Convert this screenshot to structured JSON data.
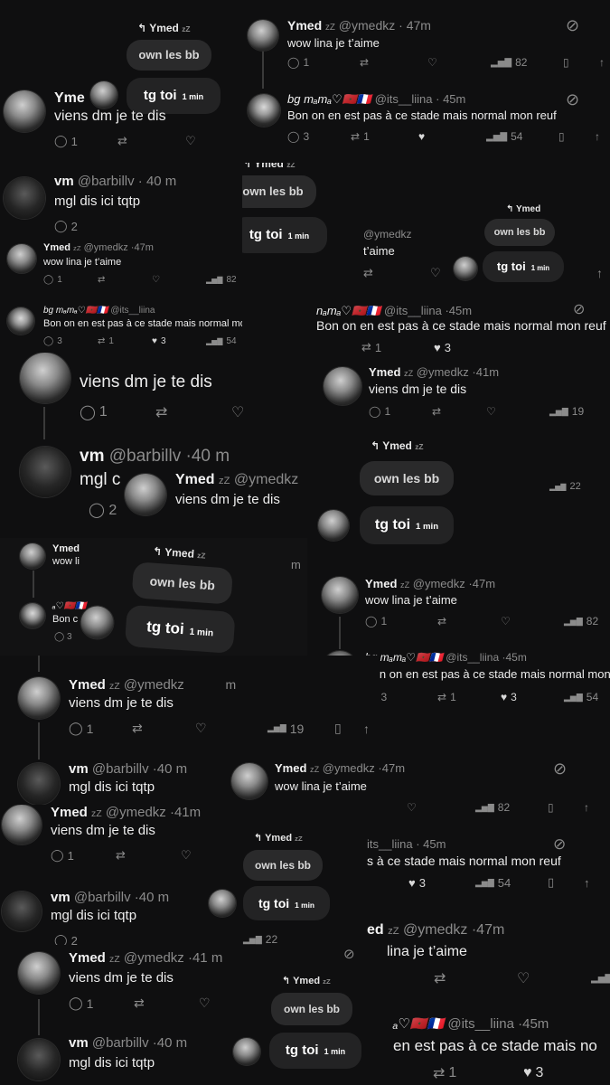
{
  "users": {
    "ymed": {
      "name": "Ymed",
      "handle": "@ymedkz",
      "zz": "zZ"
    },
    "vm": {
      "name": "vm",
      "handle": "@barbillv"
    },
    "lina": {
      "name": "bɡ mₐmₐ♡🇲🇦🇫🇷",
      "handle": "@its__liina"
    }
  },
  "tweets": {
    "t_wow": {
      "text": "wow lina je t’aime",
      "time": "47m",
      "replies": "1",
      "views": "82"
    },
    "t_bon": {
      "text": "Bon on en est pas à ce stade mais normal mon reuf",
      "time": "45m",
      "replies": "3",
      "retweets": "1",
      "likes": "3",
      "views": "54"
    },
    "t_viens": {
      "text": "viens dm je te dis",
      "time": "41m",
      "time_alt": "41 m",
      "replies": "1",
      "views": "19"
    },
    "t_mgl": {
      "text": "mgl dis ici tqtp",
      "time": "40 m",
      "replies": "2",
      "views": "22"
    }
  },
  "dm": {
    "reply_to": "Ymed",
    "bubble1": "own les bb",
    "bubble2": "tg toi",
    "bubble2_time": "1 min"
  },
  "fragments": {
    "frag_aime": "t’aime",
    "frag_min": "min",
    "frag_m": "m",
    "frag_stade": "s à ce stade mais normal mon reuf",
    "frag_linaaime": "lina je t’aime",
    "frag_its": "its__liina · 45m",
    "frag_bon2": "en est pas à ce stade mais normal mon reuf",
    "frag_bonshort": "en est pas à ce stade mais no",
    "frag_name_lina_short": "nₐmₐ♡🇲🇦🇫🇷",
    "frag_name_lina_tiny": "ₐ♡🇲🇦🇫🇷",
    "frag_ymed_cut": "Yme",
    "frag_viens_cut": "viens dm je te dis",
    "frag_mgl_cut": "mgl c",
    "frag_wow_cut": "wow li",
    "frag_bon_cut": "Bon c",
    "frag_ed": "ed"
  },
  "icons": {
    "reply": "◯",
    "retweet": "⇄",
    "like": "♡",
    "like_filled": "♥",
    "views": "▂▅▇",
    "bookmark": "▯",
    "share": "↑",
    "mute": "⊘",
    "reply_arrow": "↰"
  }
}
